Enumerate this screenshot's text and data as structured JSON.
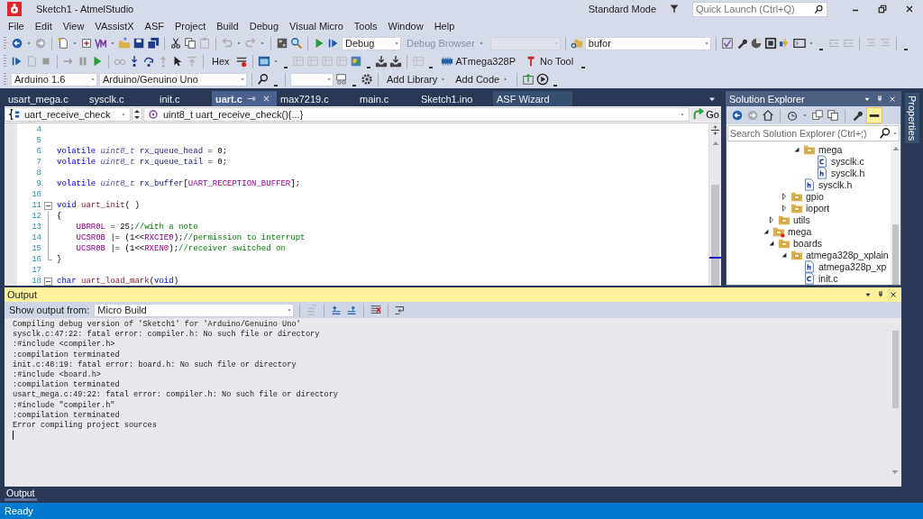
{
  "window": {
    "title": "Sketch1 - AtmelStudio",
    "mode": "Standard Mode",
    "quick_launch": {
      "placeholder": "Quick Launch (Ctrl+Q)"
    }
  },
  "menu": [
    "File",
    "Edit",
    "View",
    "VAssistX",
    "ASF",
    "Project",
    "Build",
    "Debug",
    "Visual Micro",
    "Tools",
    "Window",
    "Help"
  ],
  "toolbar_1": {
    "configuration": "Debug",
    "debug_browser": {
      "label": "Debug Browser",
      "disabled": true
    },
    "find": "bufor"
  },
  "toolbar_2": {
    "hex": "Hex",
    "device": "ATmega328P",
    "tool": "No Tool"
  },
  "toolbar_3": {
    "sdk": "Arduino 1.6",
    "board": "Arduino/Genuino Uno",
    "add_library": "Add Library",
    "add_code": "Add Code"
  },
  "tabs": [
    {
      "label": "usart_mega.c",
      "selected": false
    },
    {
      "label": "sysclk.c",
      "selected": false
    },
    {
      "label": "init.c",
      "selected": false
    },
    {
      "label": "uart.c",
      "selected": true
    },
    {
      "label": "max7219.c",
      "selected": false
    },
    {
      "label": "main.c",
      "selected": false
    },
    {
      "label": "Sketch1.ino",
      "selected": false
    },
    {
      "label": "ASF Wizard",
      "selected": false
    }
  ],
  "editor": {
    "scope": "uart_receive_check",
    "member": "uint8_t uart_receive_check(){...}",
    "go": "Go",
    "lines": [
      {
        "number": "4",
        "kind": "plain"
      },
      {
        "number": "5",
        "kind": "plain"
      },
      {
        "number": "6",
        "kind": "plain",
        "tokens": [
          {
            "kind": "kw",
            "text": "volatile "
          },
          {
            "kind": "type",
            "text": "uint8_t"
          },
          {
            "kind": "var",
            "text": " rx_queue_head "
          },
          {
            "kind": "plain",
            "text": "= 0;"
          }
        ]
      },
      {
        "number": "7",
        "kind": "plain",
        "tokens": [
          {
            "kind": "kw",
            "text": "volatile "
          },
          {
            "kind": "type",
            "text": "uint8_t"
          },
          {
            "kind": "var",
            "text": " rx_queue_tail "
          },
          {
            "kind": "plain",
            "text": "= 0;"
          }
        ]
      },
      {
        "number": "8",
        "kind": "plain"
      },
      {
        "number": "9",
        "kind": "plain",
        "tokens": [
          {
            "kind": "kw",
            "text": "volatile "
          },
          {
            "kind": "type",
            "text": "uint8_t"
          },
          {
            "kind": "var",
            "text": " rx_buffer"
          },
          {
            "kind": "plain",
            "text": "["
          },
          {
            "kind": "macro",
            "text": "UART_RECEPTION_BUFFER"
          },
          {
            "kind": "plain",
            "text": "];"
          }
        ]
      },
      {
        "number": "10",
        "kind": "plain"
      },
      {
        "number": "11",
        "kind": "fold-start",
        "tokens": [
          {
            "kind": "kw",
            "text": "void "
          },
          {
            "kind": "fn",
            "text": "uart_init"
          },
          {
            "kind": "plain",
            "text": "( )"
          }
        ]
      },
      {
        "number": "12",
        "kind": "fold-body",
        "tokens": [
          {
            "kind": "plain",
            "text": "{"
          }
        ]
      },
      {
        "number": "13",
        "kind": "fold-body",
        "indented": true,
        "tokens": [
          {
            "kind": "macro",
            "text": "UBRR0L"
          },
          {
            "kind": "plain",
            "text": " = 25;"
          },
          {
            "kind": "comment",
            "text": "//with a note"
          }
        ]
      },
      {
        "number": "14",
        "kind": "fold-body",
        "indented": true,
        "tokens": [
          {
            "kind": "macro",
            "text": "UCSR0B"
          },
          {
            "kind": "plain",
            "text": " |= (1<<"
          },
          {
            "kind": "macro",
            "text": "RXCIE0"
          },
          {
            "kind": "plain",
            "text": ");"
          },
          {
            "kind": "comment",
            "text": "//permission to interrupt"
          }
        ]
      },
      {
        "number": "15",
        "kind": "fold-body",
        "indented": true,
        "tokens": [
          {
            "kind": "macro",
            "text": "UCSR0B"
          },
          {
            "kind": "plain",
            "text": " |= (1<<"
          },
          {
            "kind": "macro",
            "text": "RXEN0"
          },
          {
            "kind": "plain",
            "text": ");"
          },
          {
            "kind": "comment",
            "text": "//receiver switched on"
          }
        ]
      },
      {
        "number": "16",
        "kind": "fold-end",
        "tokens": [
          {
            "kind": "plain",
            "text": "}"
          }
        ]
      },
      {
        "number": "17",
        "kind": "plain"
      },
      {
        "number": "18",
        "kind": "fold-start",
        "tokens": [
          {
            "kind": "kw",
            "text": "char "
          },
          {
            "kind": "fn",
            "text": "uart_load_mark"
          },
          {
            "kind": "plain",
            "text": "("
          },
          {
            "kind": "kw",
            "text": "void"
          },
          {
            "kind": "plain",
            "text": ")"
          }
        ]
      }
    ]
  },
  "solution_explorer": {
    "title": "Solution Explorer",
    "search": {
      "placeholder": "Search Solution Explorer (Ctrl+;)"
    },
    "tree": [
      {
        "children": [
          {
            "children": [
              {
                "children": [
                  {
                    "label": "mega",
                    "kind": "folder",
                    "expanded": true,
                    "children": [
                      {
                        "label": "sysclk.c",
                        "kind": "c"
                      },
                      {
                        "label": "sysclk.h",
                        "kind": "h"
                      }
                    ]
                  },
                  {
                    "label": "sysclk.h",
                    "kind": "h"
                  }
                ]
              },
              {
                "label": "gpio",
                "kind": "folder",
                "expanded": false
              },
              {
                "label": "ioport",
                "kind": "folder",
                "expanded": false
              }
            ]
          },
          {
            "label": "utils",
            "kind": "folder",
            "expanded": false
          }
        ]
      },
      {
        "label": "mega",
        "kind": "project",
        "expanded": true,
        "children": [
          {
            "label": "boards",
            "kind": "folder",
            "expanded": true,
            "children": [
              {
                "label": "atmega328p_xplain",
                "kind": "folder",
                "expanded": true,
                "children": [
                  {
                    "label": "atmega328p_xp",
                    "kind": "h"
                  },
                  {
                    "label": "init.c",
                    "kind": "c"
                  }
                ]
              }
            ]
          }
        ]
      }
    ]
  },
  "output": {
    "title": "Output",
    "source_label": "Show output from:",
    "source": "Micro Build",
    "lines": [
      "Compiling debug version of 'Sketch1' for 'Arduino/Genuino Uno'",
      "sysclk.c:47:22: fatal error: compiler.h: No such file or directory",
      ":#include <compiler.h>",
      ":compilation terminated",
      "init.c:48:19: fatal error: board.h: No such file or directory",
      ":#include <board.h>",
      ":compilation terminated",
      "usart_mega.c:49:22: fatal error: compiler.h: No such file or directory",
      ":#include \"compiler.h\"",
      ":compilation terminated",
      "Error compiling project sources"
    ]
  },
  "bottom_tab": "Output",
  "properties_tab": "Properties",
  "status_bar": "Ready"
}
